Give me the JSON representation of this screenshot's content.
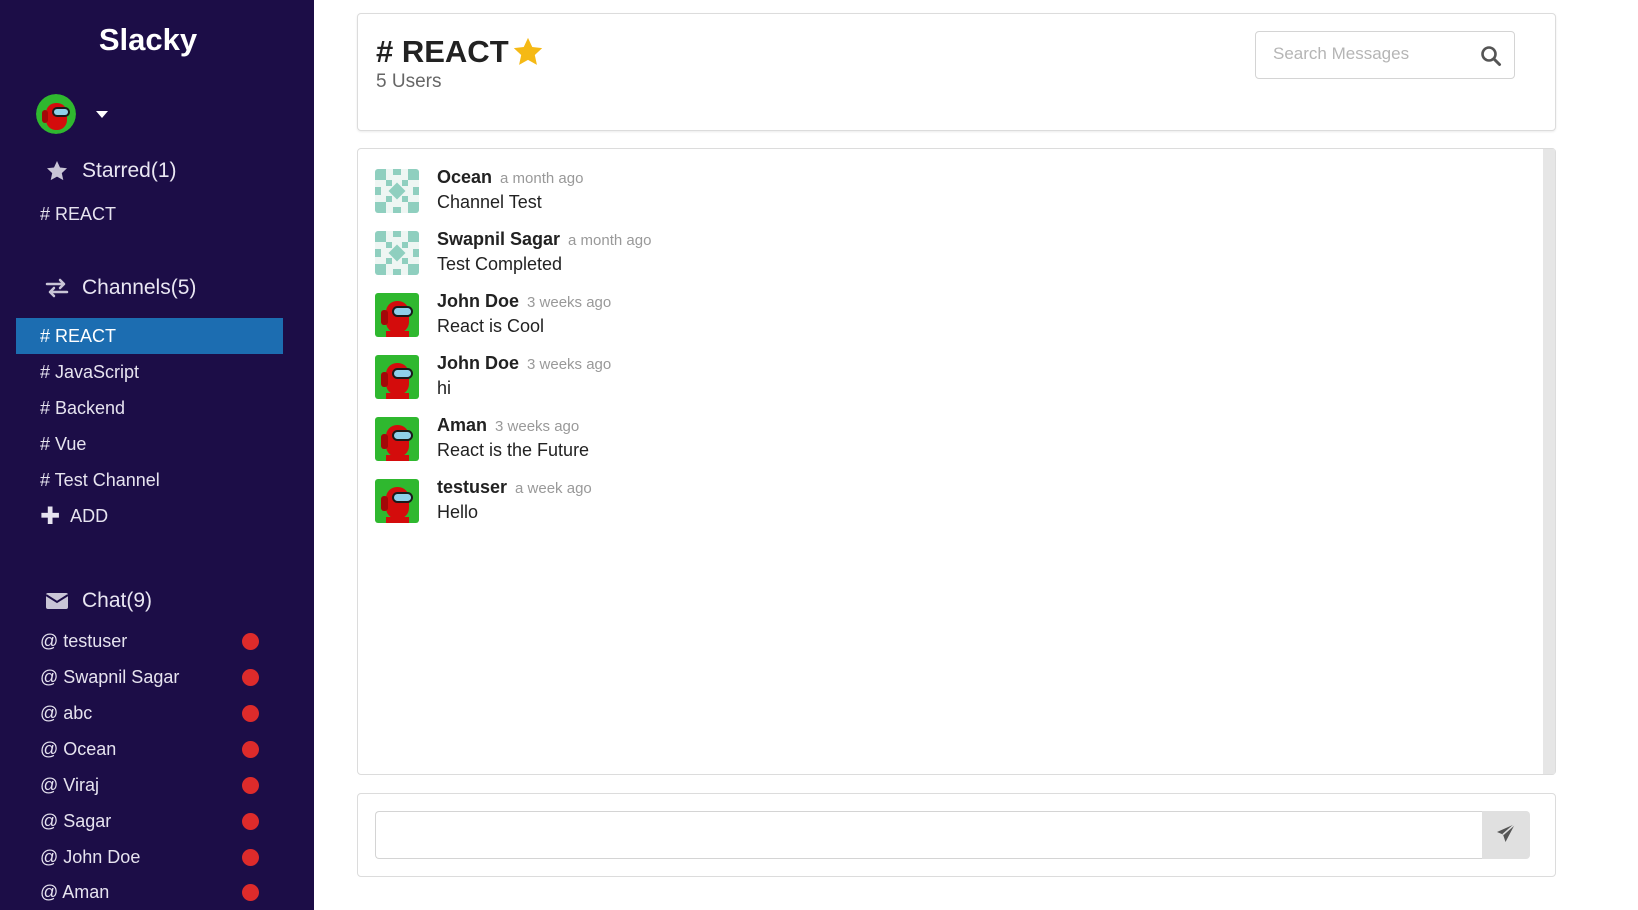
{
  "app": {
    "brand": "Slacky"
  },
  "sidebar": {
    "starred": {
      "label": "Starred(1)",
      "items": [
        {
          "label": "# REACT"
        }
      ]
    },
    "channels": {
      "label": "Channels(5)",
      "items": [
        {
          "label": "# REACT",
          "active": true
        },
        {
          "label": "# JavaScript"
        },
        {
          "label": "# Backend"
        },
        {
          "label": "# Vue"
        },
        {
          "label": "# Test Channel"
        }
      ],
      "add_label": "ADD"
    },
    "chat": {
      "label": "Chat(9)",
      "items": [
        {
          "label": "@ testuser"
        },
        {
          "label": "@ Swapnil Sagar"
        },
        {
          "label": "@ abc"
        },
        {
          "label": "@ Ocean"
        },
        {
          "label": "@ Viraj"
        },
        {
          "label": "@ Sagar"
        },
        {
          "label": "@ John Doe"
        },
        {
          "label": "@ Aman"
        }
      ]
    }
  },
  "header": {
    "title": "# REACT",
    "starred": true,
    "user_count": "5 Users",
    "search_placeholder": "Search Messages"
  },
  "messages": [
    {
      "author": "Ocean",
      "time": "a month ago",
      "text": "Channel Test",
      "avatar": "identicon"
    },
    {
      "author": "Swapnil Sagar",
      "time": "a month ago",
      "text": "Test Completed",
      "avatar": "identicon"
    },
    {
      "author": "John Doe",
      "time": "3 weeks ago",
      "text": "React is Cool",
      "avatar": "crewmate"
    },
    {
      "author": "John Doe",
      "time": "3 weeks ago",
      "text": "hi",
      "avatar": "crewmate"
    },
    {
      "author": "Aman",
      "time": "3 weeks ago",
      "text": "React is the Future",
      "avatar": "crewmate"
    },
    {
      "author": "testuser",
      "time": "a week ago",
      "text": "Hello",
      "avatar": "crewmate"
    }
  ],
  "composer": {
    "value": "",
    "placeholder": ""
  },
  "colors": {
    "sidebar_bg": "#1c0d47",
    "active_item": "#1c6db1",
    "unread_dot": "#dd2b2b",
    "star": "#f5b915"
  }
}
